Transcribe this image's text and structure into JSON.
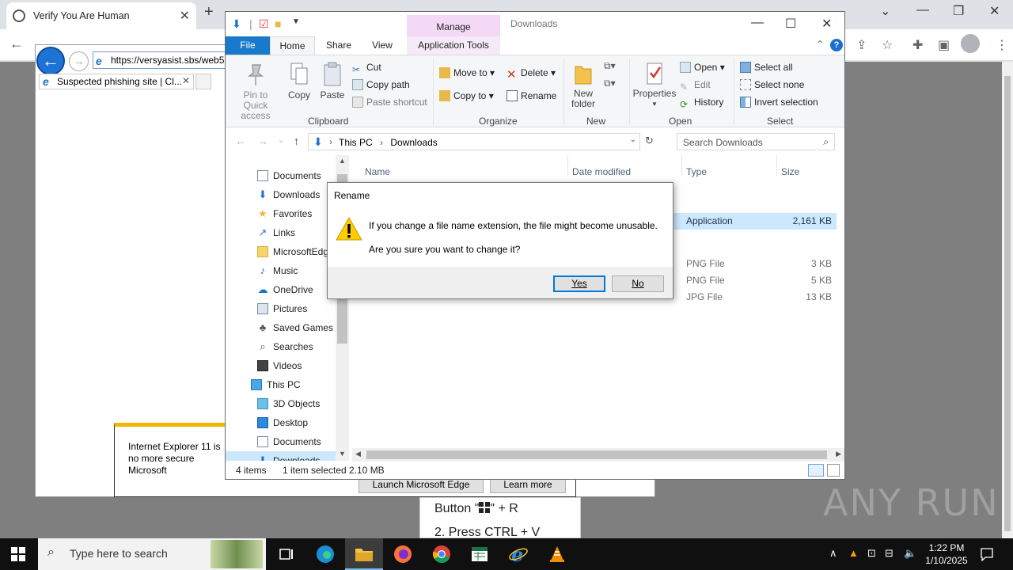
{
  "chrome": {
    "tab_title": "Verify You Are Human",
    "new_tab": "+",
    "icons": [
      "globe-icon",
      "close-icon",
      "plus-icon",
      "chevron-down-icon",
      "minimize-icon",
      "restore-icon",
      "close-icon",
      "back-arrow-icon",
      "share-icon",
      "star-icon",
      "extension-icon",
      "sidebar-icon",
      "avatar-icon"
    ]
  },
  "ie": {
    "address": "https://versyasist.sbs/web5",
    "tab_title": "Suspected phishing site | Cl...",
    "notice_text": "Internet Explorer 11 is no more secure Microsoft",
    "launch_button": "Launch Microsoft Edge",
    "learn_button": "Learn more"
  },
  "instructions": {
    "line1_prefix": "Button \"",
    "line1_suffix": "\" + R",
    "line2": "2. Press CTRL + V"
  },
  "watermark": "ANY RUN",
  "explorer": {
    "window_title": "Downloads",
    "context_tab_group": "Manage",
    "tabs": {
      "file": "File",
      "home": "Home",
      "share": "Share",
      "view": "View",
      "apptools": "Application Tools"
    },
    "ribbon": {
      "pin": "Pin to Quick access",
      "copy": "Copy",
      "paste": "Paste",
      "cut": "Cut",
      "copy_path": "Copy path",
      "paste_shortcut": "Paste shortcut",
      "clipboard": "Clipboard",
      "move_to": "Move to",
      "copy_to": "Copy to",
      "delete": "Delete",
      "rename": "Rename",
      "organize": "Organize",
      "new_folder": "New folder",
      "new": "New",
      "properties": "Properties",
      "open": "Open",
      "edit": "Edit",
      "history": "History",
      "open_group": "Open",
      "select_all": "Select all",
      "select_none": "Select none",
      "invert_selection": "Invert selection",
      "select_group": "Select"
    },
    "path": {
      "root": "This PC",
      "current": "Downloads"
    },
    "search_placeholder": "Search Downloads",
    "nav": [
      {
        "label": "Documents",
        "icon": "documents-icon"
      },
      {
        "label": "Downloads",
        "icon": "downloads-icon"
      },
      {
        "label": "Favorites",
        "icon": "star-icon"
      },
      {
        "label": "Links",
        "icon": "links-icon"
      },
      {
        "label": "MicrosoftEdg",
        "icon": "folder-icon"
      },
      {
        "label": "Music",
        "icon": "music-icon"
      },
      {
        "label": "OneDrive",
        "icon": "cloud-icon"
      },
      {
        "label": "Pictures",
        "icon": "pictures-icon"
      },
      {
        "label": "Saved Games",
        "icon": "games-icon"
      },
      {
        "label": "Searches",
        "icon": "search-icon"
      },
      {
        "label": "Videos",
        "icon": "videos-icon"
      },
      {
        "label": "This PC",
        "icon": "computer-icon"
      },
      {
        "label": "3D Objects",
        "icon": "cube-icon"
      },
      {
        "label": "Desktop",
        "icon": "desktop-icon"
      },
      {
        "label": "Documents",
        "icon": "documents-icon"
      },
      {
        "label": "Downloads",
        "icon": "downloads-icon"
      }
    ],
    "columns": {
      "name": "Name",
      "date": "Date modified",
      "type": "Type",
      "size": "Size"
    },
    "files": [
      {
        "type": "Application",
        "size": "2,161 KB",
        "selected": true
      },
      {
        "type": "PNG File",
        "size": "3 KB",
        "selected": false
      },
      {
        "type": "PNG File",
        "size": "5 KB",
        "selected": false
      },
      {
        "type": "JPG File",
        "size": "13 KB",
        "selected": false
      }
    ],
    "status": {
      "items": "4 items",
      "selected": "1 item selected",
      "size": "2.10 MB"
    }
  },
  "dialog": {
    "title": "Rename",
    "message1": "If you change a file name extension, the file might become unusable.",
    "message2": "Are you sure you want to change it?",
    "yes": "Yes",
    "no": "No"
  },
  "taskbar": {
    "search_placeholder": "Type here to search",
    "time": "1:22 PM",
    "date": "1/10/2025"
  },
  "colors": {
    "accent": "#1979ca",
    "manage_tab": "#f3d9f6",
    "selection": "#cce8ff",
    "taskbar": "#101010"
  }
}
